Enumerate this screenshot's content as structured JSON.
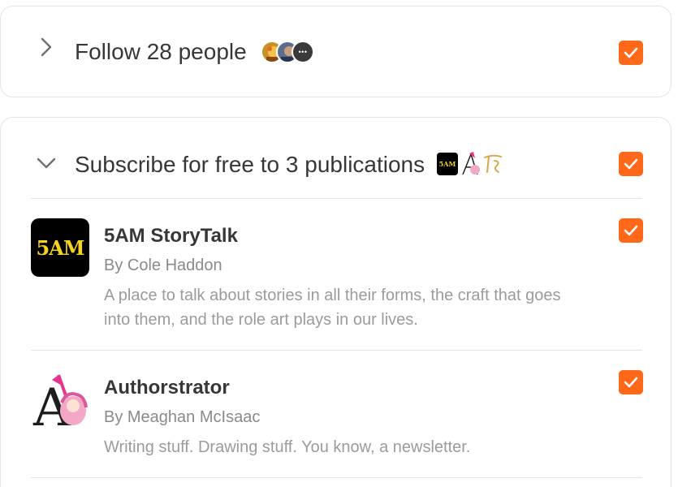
{
  "follow": {
    "title": "Follow 28 people",
    "avatars": [
      "person-avatar-1-icon",
      "person-avatar-2-icon",
      "more-icon"
    ],
    "more_label": "•••",
    "checked": true
  },
  "subscribe": {
    "title": "Subscribe for free to 3 publications",
    "checked": true,
    "mini_logo_5am": "5AM",
    "publications": [
      {
        "name": "5AM StoryTalk",
        "author": "By Cole Haddon",
        "description": "A place to talk about stories in all their forms, the craft that goes into them, and the role art plays in our lives.",
        "logo_text": "5AM",
        "checked": true
      },
      {
        "name": "Authorstrator",
        "author": "By Meaghan McIsaac",
        "description": "Writing stuff. Drawing stuff. You know, a newsletter.",
        "logo_text": "A",
        "checked": true
      }
    ]
  },
  "colors": {
    "accent": "#ff6719",
    "text": "#363737",
    "muted": "#8a8a8a",
    "border": "#e4e4e4"
  }
}
